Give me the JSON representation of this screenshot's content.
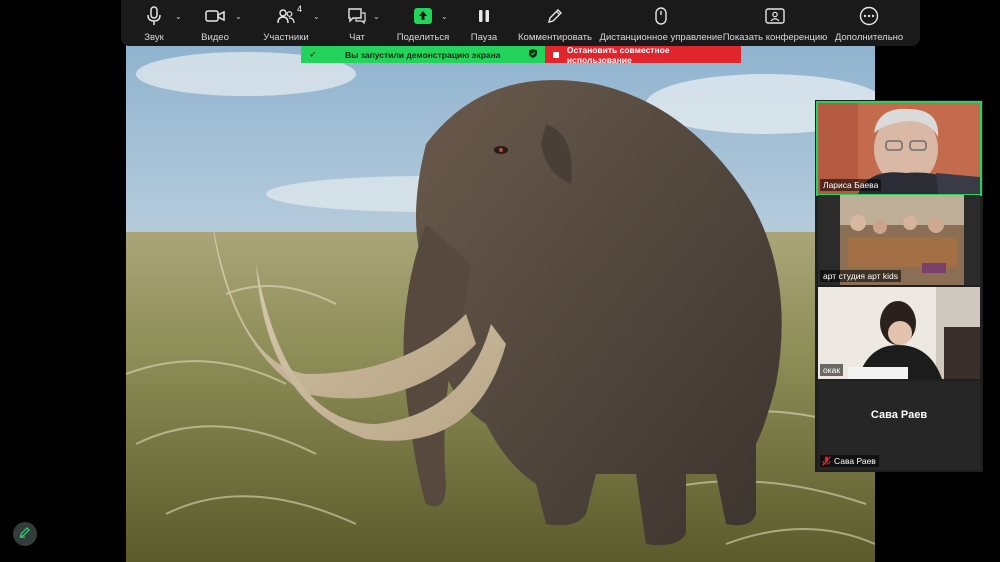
{
  "toolbar": {
    "items": [
      {
        "label": "Звук",
        "icon": "microphone-icon"
      },
      {
        "label": "Видео",
        "icon": "video-camera-icon"
      },
      {
        "label": "Участники",
        "icon": "participants-icon",
        "count": "4"
      },
      {
        "label": "Чат",
        "icon": "chat-icon"
      },
      {
        "label": "Поделиться",
        "icon": "share-screen-icon"
      },
      {
        "label": "Пауза",
        "icon": "pause-icon"
      },
      {
        "label": "Комментировать",
        "icon": "pencil-icon"
      },
      {
        "label": "Дистанционное управление",
        "icon": "mouse-icon"
      },
      {
        "label": "Показать конференцию",
        "icon": "show-meeting-icon"
      },
      {
        "label": "Дополнительно",
        "icon": "more-icon"
      }
    ]
  },
  "banners": {
    "sharing": "Вы запустили демонстрацию экрана",
    "stop": "Остановить совместное использование"
  },
  "participants": [
    {
      "name": "Лариса Баева",
      "active": true
    },
    {
      "name": "арт студия арт kids"
    },
    {
      "name": "окак"
    },
    {
      "name": "Сава Раев",
      "display": "Сава Раев",
      "muted": true
    }
  ],
  "colors": {
    "accent": "#23d35b",
    "stop": "#e0252d",
    "toolbar": "#1a1a1a"
  }
}
